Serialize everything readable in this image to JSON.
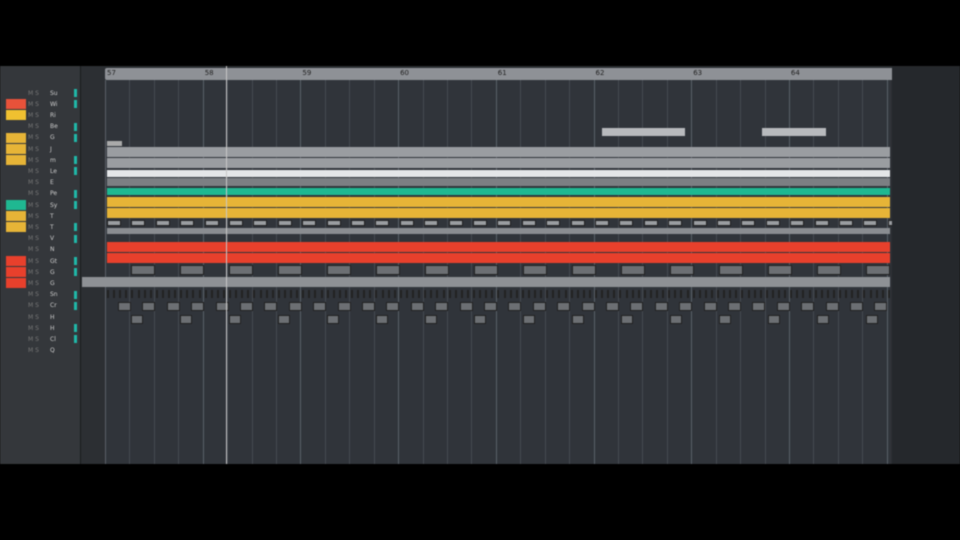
{
  "ruler": {
    "bars": [
      "57",
      "58",
      "59",
      "60",
      "61",
      "62",
      "63",
      "64"
    ]
  },
  "tracks": [
    {
      "name": "Su",
      "color": ""
    },
    {
      "name": "Wi",
      "color": "#e8523a"
    },
    {
      "name": "Ri",
      "color": "#f0c030"
    },
    {
      "name": "Be",
      "color": ""
    },
    {
      "name": "G",
      "color": "#e6b437"
    },
    {
      "name": "J",
      "color": "#e6b437"
    },
    {
      "name": "m",
      "color": "#e6b437"
    },
    {
      "name": "Le",
      "color": ""
    },
    {
      "name": "E",
      "color": ""
    },
    {
      "name": "Pe",
      "color": ""
    },
    {
      "name": "Sy",
      "color": "#1fb891"
    },
    {
      "name": "T",
      "color": "#e6b437"
    },
    {
      "name": "T",
      "color": "#e6b437"
    },
    {
      "name": "V",
      "color": ""
    },
    {
      "name": "N",
      "color": ""
    },
    {
      "name": "Gt",
      "color": "#e8402c"
    },
    {
      "name": "G",
      "color": "#e8402c"
    },
    {
      "name": "G",
      "color": "#e8402c"
    },
    {
      "name": "Sn",
      "color": ""
    },
    {
      "name": "Cr",
      "color": ""
    },
    {
      "name": "H",
      "color": ""
    },
    {
      "name": "H",
      "color": ""
    },
    {
      "name": "Cl",
      "color": ""
    },
    {
      "name": "Q",
      "color": ""
    }
  ],
  "colors": {
    "teal": "#1fb891",
    "yellow": "#e6b437",
    "red": "#e8402c",
    "gray": "#9a9da1",
    "white": "#e4e6e8"
  }
}
